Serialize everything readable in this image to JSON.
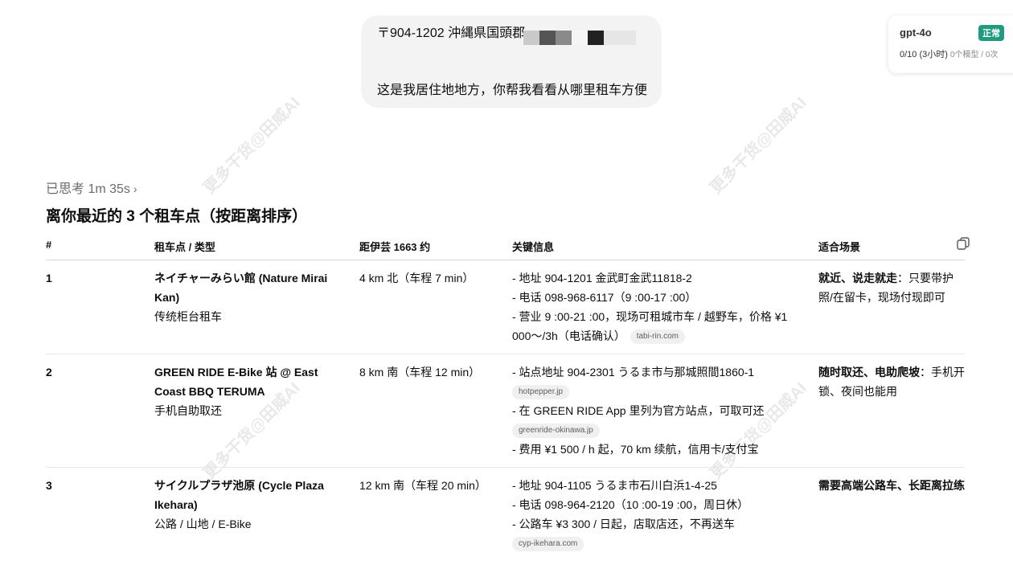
{
  "user_message": {
    "address_line": "〒904-1202 沖縄県国頭郡",
    "message_line": "这是我居住地地方，你帮我看看从哪里租车方便"
  },
  "model_card": {
    "name": "gpt-4o",
    "status": "正常",
    "usage": "0/10 (3小时)",
    "usage_sub": "0个模型 / 0次"
  },
  "thinking": {
    "label": "已思考 1m 35s"
  },
  "section_title": "离你最近的 3 个租车点（按距离排序）",
  "table": {
    "headers": {
      "num": "#",
      "name": "租车点 / 类型",
      "distance": "距伊芸 1663 约",
      "info": "关键信息",
      "fit": "适合场景"
    },
    "rows": [
      {
        "num": "1",
        "name": "ネイチャーみらい館 (Nature Mirai Kan)",
        "type": "传统柜台租车",
        "distance": "4 km 北（车程 7 min）",
        "info": [
          {
            "text": "- 地址 904-1201 金武町金武11818-2",
            "source": ""
          },
          {
            "text": "- 电话 098-968-6117（9 :00-17 :00）",
            "source": ""
          },
          {
            "text": "- 营业 9 :00-21 :00，现场可租城市车 / 越野车，价格 ¥1 000～/3h（电话确认）",
            "source": "tabi-rin.com"
          }
        ],
        "fit_bold": "就近、说走就走",
        "fit_rest": "：只要带护照/在留卡，现场付现即可"
      },
      {
        "num": "2",
        "name": "GREEN RIDE E-Bike 站 @ East Coast BBQ TERUMA",
        "type": "手机自助取还",
        "distance": "8 km 南（车程 12 min）",
        "info": [
          {
            "text": "- 站点地址 904-2301 うるま市与那城照間1860-1",
            "source": "hotpepper.jp"
          },
          {
            "text": "- 在 GREEN RIDE App 里列为官方站点，可取可还",
            "source": "greenride-okinawa.jp"
          },
          {
            "text": "- 费用 ¥1 500 / h 起，70 km 续航，信用卡/支付宝",
            "source": ""
          }
        ],
        "fit_bold": "随时取还、电助爬坡",
        "fit_rest": "：手机开锁、夜间也能用"
      },
      {
        "num": "3",
        "name": "サイクルプラザ池原 (Cycle Plaza Ikehara)",
        "type": "公路 / 山地 / E-Bike",
        "distance": "12 km 南（车程 20 min）",
        "info": [
          {
            "text": "- 地址 904-1105 うるま市石川白浜1-4-25",
            "source": ""
          },
          {
            "text": "- 电话 098-964-2120（10 :00-19 :00，周日休）",
            "source": ""
          },
          {
            "text": "- 公路车 ¥3 300 / 日起，店取店还，不再送车",
            "source": "cyp-ikehara.com"
          }
        ],
        "fit_bold": "需要高端公路车、长距离拉练",
        "fit_rest": ""
      }
    ]
  },
  "watermark": "更多干货@田威AI",
  "colors": {
    "badge_green": "#1f9b7f",
    "bubble_bg": "#f3f3f3"
  }
}
